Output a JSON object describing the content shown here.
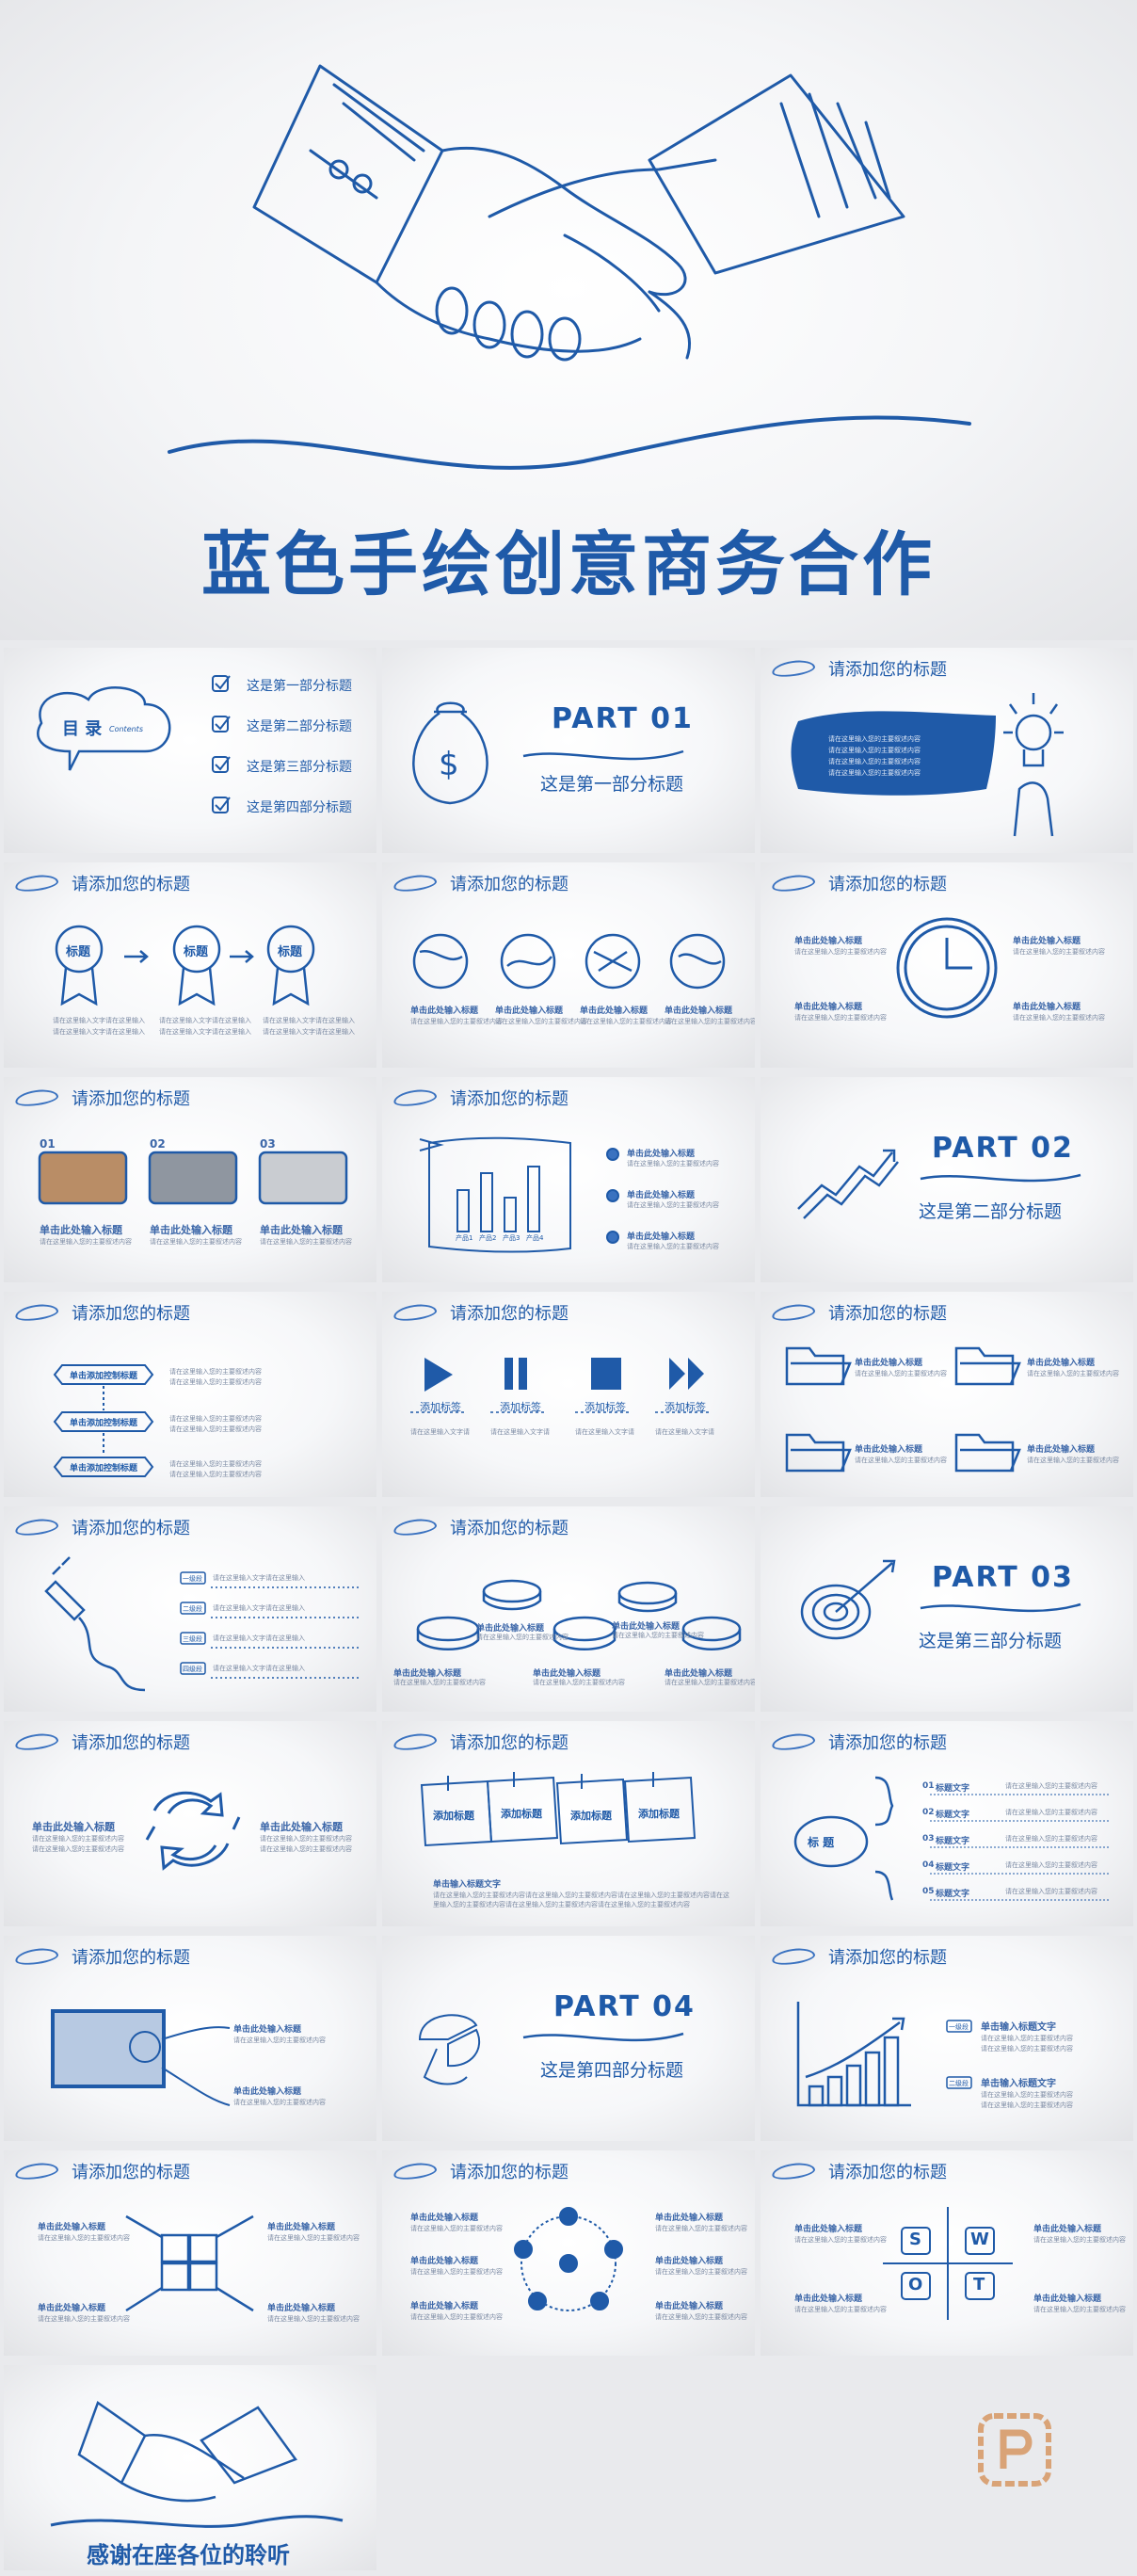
{
  "cover": {
    "title": "蓝色手绘创意商务合作"
  },
  "header": {
    "title": "请添加您的标题",
    "logo_icon": "cloud-logo-icon"
  },
  "toc": {
    "label": "目 录",
    "sub": "Contents",
    "items": [
      "这是第一部分标题",
      "这是第二部分标题",
      "这是第三部分标题",
      "这是第四部分标题"
    ]
  },
  "parts": [
    {
      "label": "PART   01",
      "title": "这是第一部分标题"
    },
    {
      "label": "PART   02",
      "title": "这是第二部分标题"
    },
    {
      "label": "PART   03",
      "title": "这是第三部分标题"
    },
    {
      "label": "PART   04",
      "title": "这是第四部分标题"
    }
  ],
  "common": {
    "click_title": "单击此处输入标题",
    "body_line": "请在这里输入您的主要叙述内容",
    "body_short": "请在这里输入文字请",
    "add_title": "添加标题",
    "add_label": "添加标签",
    "title_label": "标题",
    "small_title": "标 题",
    "title_text": "标题文字",
    "click_title_text": "单击输入标题文字",
    "input_text": "请在这里输入文字请在这里输入",
    "product_labels": [
      "产品1",
      "产品2",
      "产品3",
      "产品4"
    ],
    "numbers": [
      "01",
      "02",
      "03"
    ],
    "list_nums": [
      "01",
      "02",
      "03",
      "04",
      "05"
    ],
    "step_tags": [
      "一级段",
      "二级段",
      "三级段",
      "四级段"
    ],
    "sub_tags": [
      "一级段",
      "二级段"
    ],
    "flow_labels": [
      "单击添加控制标题",
      "单击添加控制标题",
      "单击添加控制标题"
    ],
    "swot": [
      "S",
      "W",
      "O",
      "T"
    ],
    "long_text": "请在这里输入您的主要叙述内容请在这里输入您的主要叙述内容请在这里输入您的主要叙述内容请在这里输入您的主要叙述内容请在这里输入您的主要叙述内容请在这里输入您的主要叙述内容"
  },
  "ending": {
    "title": "感谢在座各位的聆听"
  },
  "colors": {
    "accent": "#1f5aa8",
    "background": "#e9eaed",
    "watermark": "#d9a377"
  }
}
